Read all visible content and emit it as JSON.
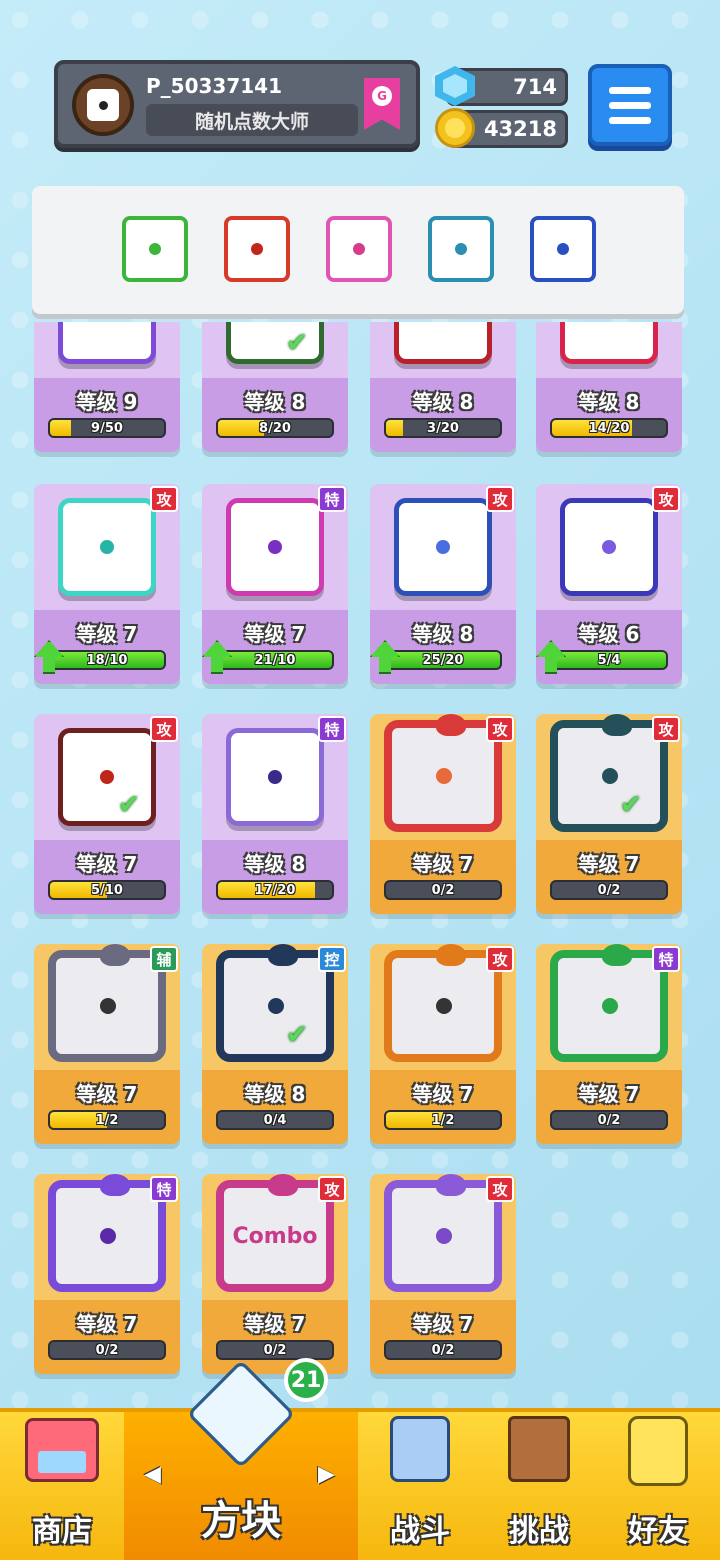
{
  "player": {
    "name": "P_50337141",
    "title": "随机点数大师",
    "rank_badge": "G"
  },
  "currency": {
    "gems": "714",
    "coins": "43218"
  },
  "deck": [
    {
      "name": "poison-dice",
      "border": "#3cb53c",
      "pip": "#3cb53c"
    },
    {
      "name": "fire-dice",
      "border": "#d83a2a",
      "pip": "#c0261a"
    },
    {
      "name": "shield-dice",
      "border": "#e055b4",
      "pip": "#d83a8e"
    },
    {
      "name": "dragon-teal-dice",
      "border": "#2a8fb0",
      "pip": "#2a8fb0"
    },
    {
      "name": "dragon-blue-dice",
      "border": "#2a4fc0",
      "pip": "#2a4fc0"
    }
  ],
  "cards": [
    {
      "rarity": "epic",
      "level": "等级 9",
      "progress": "9/50",
      "fill": 0.18,
      "bar": "yellow",
      "face": "#7e4bd8",
      "pip": "#b5a3e8",
      "tag": null,
      "upgrade": false,
      "check": false,
      "dragon": false
    },
    {
      "rarity": "epic",
      "level": "等级 8",
      "progress": "8/20",
      "fill": 0.4,
      "bar": "yellow",
      "face": "#2f6b2f",
      "pip": "#2f6b2f",
      "tag": null,
      "upgrade": false,
      "check": true,
      "dragon": false
    },
    {
      "rarity": "epic",
      "level": "等级 8",
      "progress": "3/20",
      "fill": 0.15,
      "bar": "yellow",
      "face": "#b8202a",
      "pip": "#b8202a",
      "tag": null,
      "upgrade": false,
      "check": false,
      "dragon": false
    },
    {
      "rarity": "epic",
      "level": "等级 8",
      "progress": "14/20",
      "fill": 0.7,
      "bar": "yellow",
      "face": "#d8244a",
      "pip": "#d8244a",
      "tag": null,
      "upgrade": false,
      "check": false,
      "dragon": false
    },
    {
      "rarity": "epic",
      "level": "等级 7",
      "progress": "18/10",
      "fill": 1.0,
      "bar": "green",
      "face": "#3dd6c6",
      "pip": "#27b3a6",
      "tag": "攻",
      "tagColor": "#e02b38",
      "upgrade": true,
      "check": false,
      "dragon": false
    },
    {
      "rarity": "epic",
      "level": "等级 7",
      "progress": "21/10",
      "fill": 1.0,
      "bar": "green",
      "face": "#d03ab0",
      "pip": "#7a2fc0",
      "tag": "特",
      "tagColor": "#8a3ad0",
      "upgrade": true,
      "check": false,
      "dragon": false
    },
    {
      "rarity": "epic",
      "level": "等级 8",
      "progress": "25/20",
      "fill": 1.0,
      "bar": "green",
      "face": "#2d4fb8",
      "pip": "#4a6ee0",
      "tag": "攻",
      "tagColor": "#e02b38",
      "upgrade": true,
      "check": false,
      "dragon": false
    },
    {
      "rarity": "epic",
      "level": "等级 6",
      "progress": "5/4",
      "fill": 1.0,
      "bar": "green",
      "face": "#3a3ab8",
      "pip": "#7a5ae0",
      "tag": "攻",
      "tagColor": "#e02b38",
      "upgrade": true,
      "check": false,
      "dragon": false
    },
    {
      "rarity": "epic",
      "level": "等级 7",
      "progress": "5/10",
      "fill": 0.5,
      "bar": "yellow",
      "face": "#6e1f1f",
      "pip": "#c0261a",
      "tag": "攻",
      "tagColor": "#e02b38",
      "upgrade": false,
      "check": true,
      "dragon": false
    },
    {
      "rarity": "epic",
      "level": "等级 8",
      "progress": "17/20",
      "fill": 0.85,
      "bar": "yellow",
      "face": "#8a6ad8",
      "pip": "#3a2a8a",
      "tag": "特",
      "tagColor": "#8a3ad0",
      "upgrade": false,
      "check": false,
      "dragon": false
    },
    {
      "rarity": "legend",
      "level": "等级 7",
      "progress": "0/2",
      "fill": 0,
      "bar": "yellow",
      "face": "#d83a3a",
      "pip": "#e86a3a",
      "tag": "攻",
      "tagColor": "#e02b38",
      "upgrade": false,
      "check": false,
      "dragon": true
    },
    {
      "rarity": "legend",
      "level": "等级 7",
      "progress": "0/2",
      "fill": 0,
      "bar": "yellow",
      "face": "#24505a",
      "pip": "#24505a",
      "tag": "攻",
      "tagColor": "#e02b38",
      "upgrade": false,
      "check": true,
      "dragon": true
    },
    {
      "rarity": "legend",
      "level": "等级 7",
      "progress": "1/2",
      "fill": 0.5,
      "bar": "yellow",
      "face": "#6a6a80",
      "pip": "#333333",
      "tag": "辅",
      "tagColor": "#2a9a5a",
      "upgrade": false,
      "check": false,
      "dragon": true
    },
    {
      "rarity": "legend",
      "level": "等级 8",
      "progress": "0/4",
      "fill": 0,
      "bar": "yellow",
      "face": "#22385a",
      "pip": "#22385a",
      "tag": "控",
      "tagColor": "#2a8ad8",
      "upgrade": false,
      "check": true,
      "dragon": true
    },
    {
      "rarity": "legend",
      "level": "等级 7",
      "progress": "1/2",
      "fill": 0.5,
      "bar": "yellow",
      "face": "#e07a1a",
      "pip": "#333333",
      "tag": "攻",
      "tagColor": "#e02b38",
      "upgrade": false,
      "check": false,
      "dragon": true
    },
    {
      "rarity": "legend",
      "level": "等级 7",
      "progress": "0/2",
      "fill": 0,
      "bar": "yellow",
      "face": "#2aa84a",
      "pip": "#2aa84a",
      "tag": "特",
      "tagColor": "#8a3ad0",
      "upgrade": false,
      "check": false,
      "dragon": true
    },
    {
      "rarity": "legend",
      "level": "等级 7",
      "progress": "0/2",
      "fill": 0,
      "bar": "yellow",
      "face": "#7a4ad8",
      "pip": "#5a2aa8",
      "tag": "特",
      "tagColor": "#8a3ad0",
      "upgrade": false,
      "check": false,
      "dragon": true
    },
    {
      "rarity": "legend",
      "level": "等级 7",
      "progress": "0/2",
      "fill": 0,
      "bar": "yellow",
      "face": "#c83a8a",
      "pip": "#c83a8a",
      "tag": "攻",
      "tagColor": "#e02b38",
      "upgrade": false,
      "check": false,
      "dragon": true,
      "text": "Combo"
    },
    {
      "rarity": "legend",
      "level": "等级 7",
      "progress": "0/2",
      "fill": 0,
      "bar": "yellow",
      "face": "#8a5ad8",
      "pip": "#7a4ac8",
      "tag": "攻",
      "tagColor": "#e02b38",
      "upgrade": false,
      "check": false,
      "dragon": true
    }
  ],
  "nav": {
    "shop": "商店",
    "dice": "方块",
    "dice_badge": "21",
    "battle": "战斗",
    "challenge": "挑战",
    "friends": "好友"
  }
}
